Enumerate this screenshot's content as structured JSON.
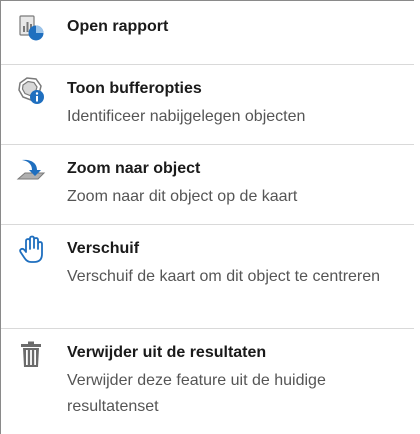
{
  "menu": {
    "items": [
      {
        "icon": "report-icon",
        "title": "Open rapport"
      },
      {
        "icon": "buffer-icon",
        "title": "Toon bufferopties",
        "description": "Identificeer nabijgelegen objecten"
      },
      {
        "icon": "zoom-to-icon",
        "title": "Zoom naar object",
        "description": "Zoom naar dit object op de kaart"
      },
      {
        "icon": "pan-hand-icon",
        "title": "Verschuif",
        "description": "Verschuif de kaart om dit object te centreren"
      },
      {
        "icon": "trash-icon",
        "title": "Verwijder uit de resultaten",
        "description": "Verwijder deze feature uit de huidige resultatenset"
      }
    ]
  },
  "colors": {
    "accent_blue": "#1f6fbf",
    "icon_gray": "#6b6b6b",
    "divider": "#d9d9d9"
  }
}
